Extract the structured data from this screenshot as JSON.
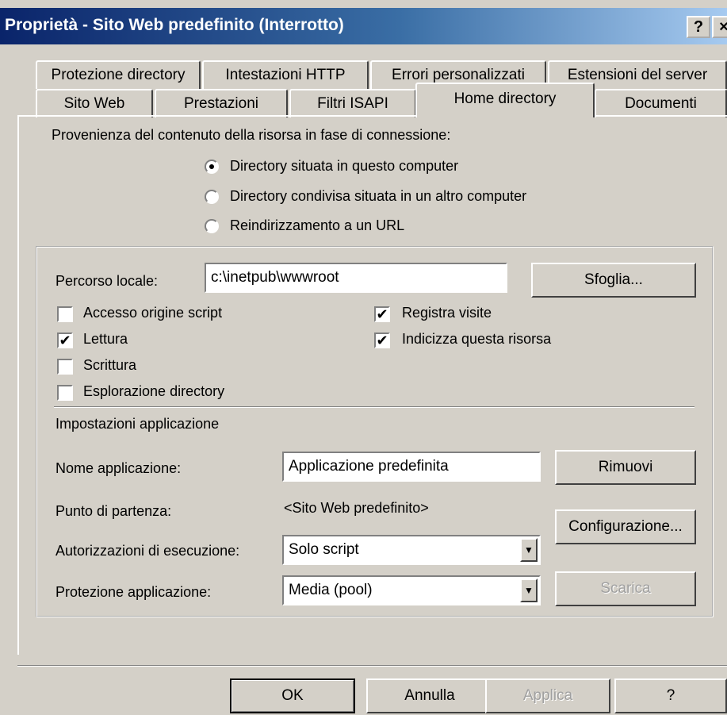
{
  "window": {
    "title": "Proprietà - Sito Web predefinito (Interrotto)",
    "help_glyph": "?",
    "close_glyph": "×"
  },
  "tabs": {
    "row1": [
      "Protezione directory",
      "Intestazioni HTTP",
      "Errori personalizzati",
      "Estensioni del server"
    ],
    "row2": [
      "Sito Web",
      "Prestazioni",
      "Filtri ISAPI",
      "Home directory",
      "Documenti"
    ],
    "active": "Home directory"
  },
  "content_source": {
    "label": "Provenienza del contenuto della risorsa in fase di connessione:",
    "options": [
      {
        "label": "Directory situata in questo computer",
        "selected": true
      },
      {
        "label": "Directory condivisa situata in un altro computer",
        "selected": false
      },
      {
        "label": "Reindirizzamento a un URL",
        "selected": false
      }
    ]
  },
  "local_path": {
    "label": "Percorso locale:",
    "value": "c:\\inetpub\\wwwroot",
    "browse_label": "Sfoglia..."
  },
  "permissions": {
    "left": [
      {
        "label": "Accesso origine script",
        "checked": false
      },
      {
        "label": "Lettura",
        "checked": true
      },
      {
        "label": "Scrittura",
        "checked": false
      },
      {
        "label": "Esplorazione directory",
        "checked": false
      }
    ],
    "right": [
      {
        "label": "Registra visite",
        "checked": true
      },
      {
        "label": "Indicizza questa risorsa",
        "checked": true
      }
    ],
    "check_glyph": "✔"
  },
  "app_settings": {
    "heading": "Impostazioni applicazione",
    "app_name_label": "Nome applicazione:",
    "app_name_value": "Applicazione predefinita",
    "remove_label": "Rimuovi",
    "start_point_label": "Punto di partenza:",
    "start_point_value": "<Sito Web predefinito>",
    "config_label": "Configurazione...",
    "exec_perm_label": "Autorizzazioni di esecuzione:",
    "exec_perm_value": "Solo script",
    "protection_label": "Protezione applicazione:",
    "protection_value": "Media (pool)",
    "unload_label": "Scarica",
    "dropdown_glyph": "▼"
  },
  "footer": {
    "ok": "OK",
    "cancel": "Annulla",
    "apply": "Applica",
    "help": "?"
  }
}
